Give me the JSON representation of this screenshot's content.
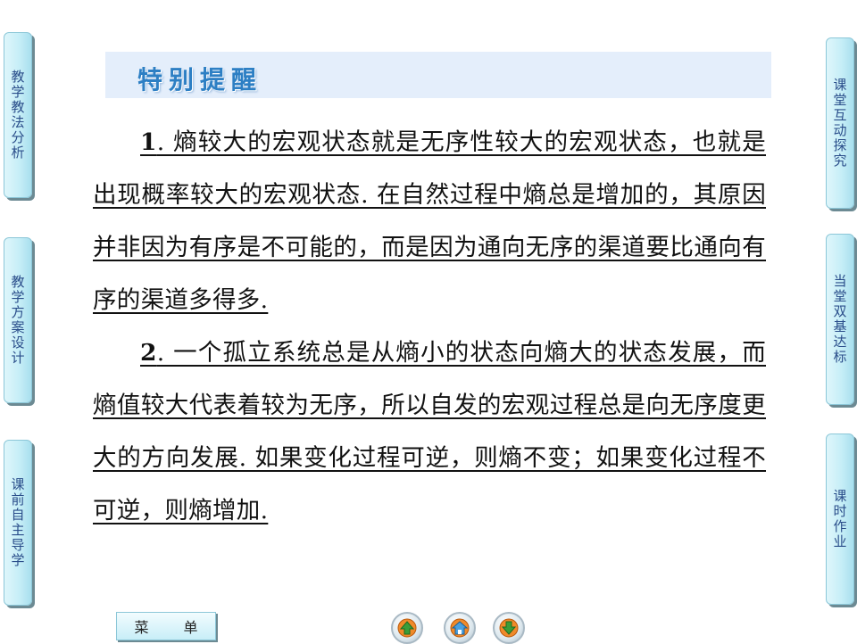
{
  "left_nav": [
    {
      "label": "教学教法分析"
    },
    {
      "label": "教学方案设计"
    },
    {
      "label": "课前自主导学"
    }
  ],
  "right_nav": [
    {
      "label": "课堂互动探究"
    },
    {
      "label": "当堂双基达标"
    },
    {
      "label": "课时作业"
    }
  ],
  "banner": {
    "title": "特别提醒"
  },
  "content": {
    "p1_num": "1",
    "p1_text": ". 熵较大的宏观状态就是无序性较大的宏观状态，也就是出现概率较大的宏观状态. 在自然过程中熵总是增加的，其原因并非因为有序是不可能的，而是因为通向无序的渠道要比通向有序的渠道多得多.",
    "p2_num": "2",
    "p2_text": ". 一个孤立系统总是从熵小的状态向熵大的状态发展，而熵值较大代表着较为无序，所以自发的宏观过程总是向无序度更大的方向发展. 如果变化过程可逆，则熵不变；如果变化过程不可逆，则熵增加."
  },
  "bottom_bar": {
    "menu_char_1": "菜",
    "menu_char_2": "单"
  },
  "icons": {
    "prev": "up-arrow-icon",
    "home": "home-icon",
    "next": "down-arrow-icon"
  },
  "colors": {
    "tab_fill": "#c6eef7",
    "banner_fill": "#e4eefb",
    "banner_text": "#2d7fc4",
    "nav_arrow": "#e07b1a"
  }
}
